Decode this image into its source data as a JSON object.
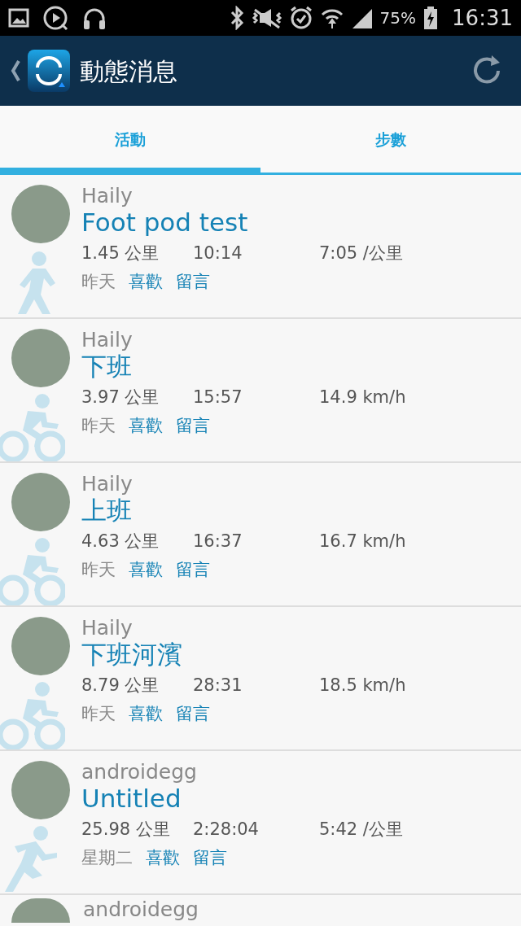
{
  "status_bar": {
    "battery_text": "75%",
    "time": "16:31"
  },
  "app_bar": {
    "title": "動態消息"
  },
  "tabs": [
    {
      "label": "活動",
      "selected": true
    },
    {
      "label": "步數",
      "selected": false
    }
  ],
  "feed": [
    {
      "user": "Haily",
      "title": "Foot pod test",
      "distance": "1.45 公里",
      "duration": "10:14",
      "pace": "7:05 /公里",
      "date": "昨天",
      "like": "喜歡",
      "comment": "留言",
      "kind": "walk"
    },
    {
      "user": "Haily",
      "title": "下班",
      "distance": "3.97 公里",
      "duration": "15:57",
      "pace": "14.9 km/h",
      "date": "昨天",
      "like": "喜歡",
      "comment": "留言",
      "kind": "bike"
    },
    {
      "user": "Haily",
      "title": "上班",
      "distance": "4.63 公里",
      "duration": "16:37",
      "pace": "16.7 km/h",
      "date": "昨天",
      "like": "喜歡",
      "comment": "留言",
      "kind": "bike"
    },
    {
      "user": "Haily",
      "title": "下班河濱",
      "distance": "8.79 公里",
      "duration": "28:31",
      "pace": "18.5 km/h",
      "date": "昨天",
      "like": "喜歡",
      "comment": "留言",
      "kind": "bike"
    },
    {
      "user": "androidegg",
      "title": "Untitled",
      "distance": "25.98 公里",
      "duration": "2:28:04",
      "pace": "5:42 /公里",
      "date": "星期二",
      "like": "喜歡",
      "comment": "留言",
      "kind": "run"
    }
  ],
  "partial_row": {
    "user": "androidegg"
  }
}
